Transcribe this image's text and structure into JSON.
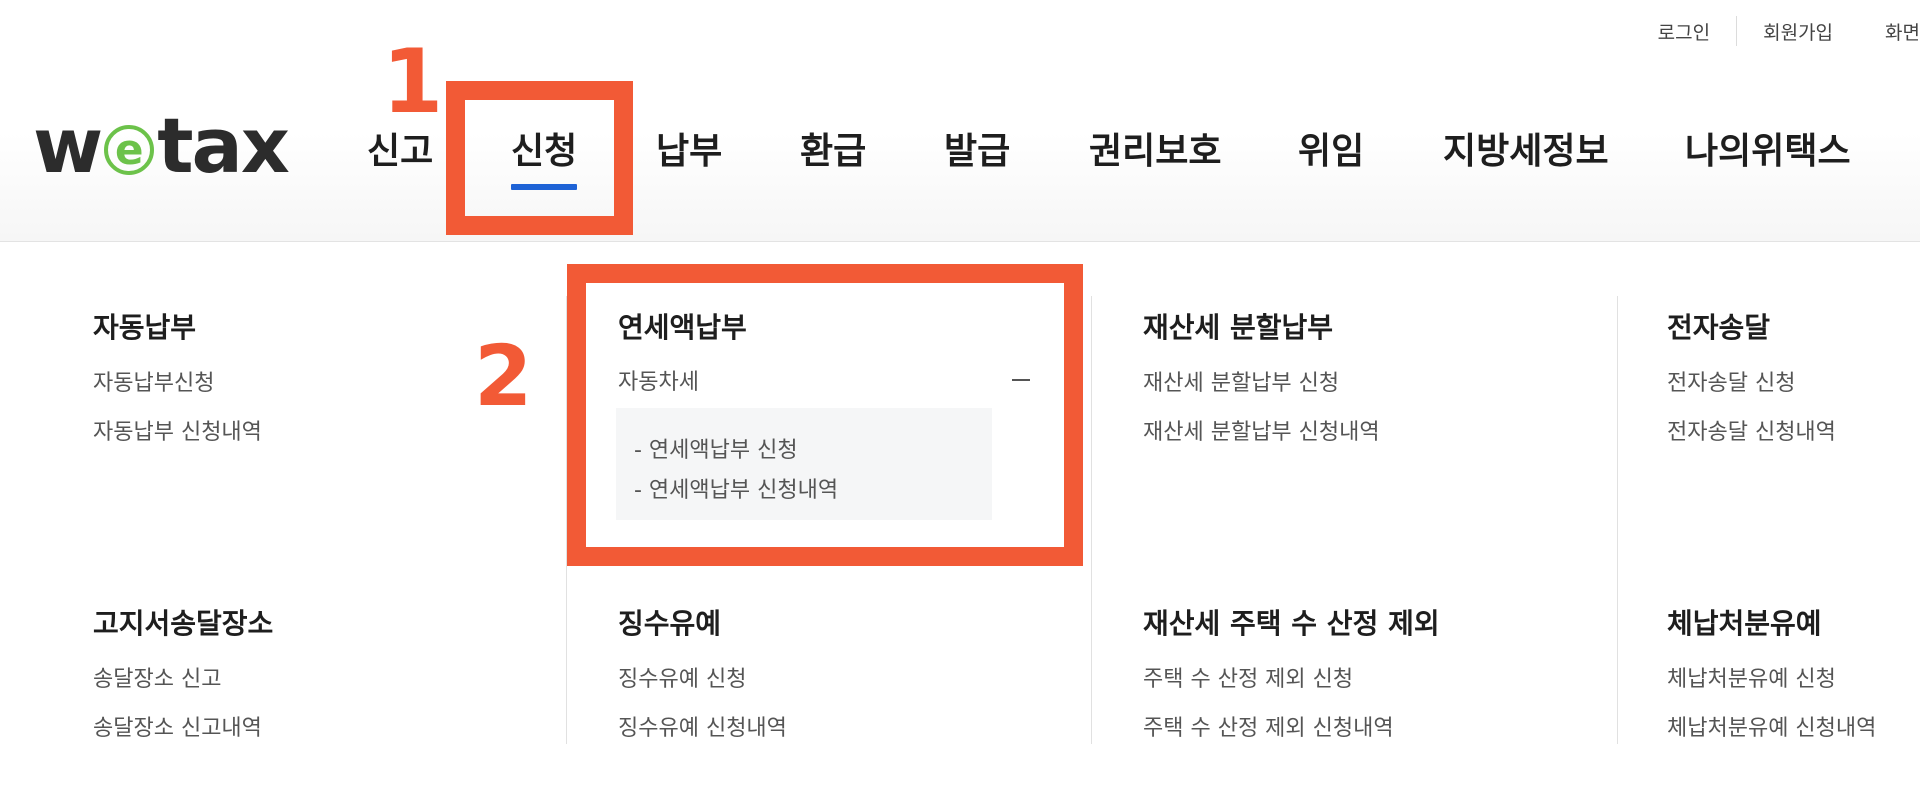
{
  "util": {
    "login": "로그인",
    "join": "회원가입",
    "screen": "화면"
  },
  "logo": {
    "pre": "w",
    "e": "e",
    "post": "tax"
  },
  "gnb": [
    "신고",
    "신청",
    "납부",
    "환급",
    "발급",
    "권리보호",
    "위임",
    "지방세정보",
    "나의위택스"
  ],
  "groups": [
    {
      "title": "자동납부",
      "links": [
        "자동납부신청",
        "자동납부 신청내역"
      ]
    },
    {
      "title": "연세액납부",
      "toggle": "자동차세",
      "sub": [
        "- 연세액납부 신청",
        "- 연세액납부 신청내역"
      ]
    },
    {
      "title": "재산세 분할납부",
      "links": [
        "재산세 분할납부 신청",
        "재산세 분할납부 신청내역"
      ]
    },
    {
      "title": "전자송달",
      "links": [
        "전자송달 신청",
        "전자송달 신청내역"
      ]
    },
    {
      "title": "고지서송달장소",
      "links": [
        "송달장소 신고",
        "송달장소 신고내역"
      ]
    },
    {
      "title": "징수유예",
      "links": [
        "징수유예 신청",
        "징수유예 신청내역"
      ]
    },
    {
      "title": "재산세 주택 수 산정 제외",
      "links": [
        "주택 수 산정 제외 신청",
        "주택 수 산정 제외 신청내역"
      ]
    },
    {
      "title": "체납처분유예",
      "links": [
        "체납처분유예 신청",
        "체납처분유예 신청내역"
      ]
    }
  ],
  "annotations": {
    "one": "1",
    "two": "2"
  },
  "colors": {
    "highlight": "#f25a36",
    "active_underline": "#1e63d6",
    "logo_green": "#6cc24a"
  }
}
